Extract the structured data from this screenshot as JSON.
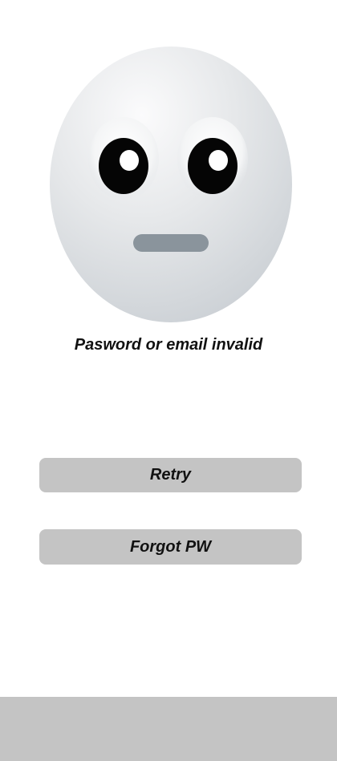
{
  "status": {
    "message": "Pasword or email invalid",
    "illustration_icon": "neutral-face-icon"
  },
  "actions": {
    "retry_label": "Retry",
    "forgot_label": "Forgot PW"
  },
  "colors": {
    "button_bg": "#c4c4c4",
    "bottom_bar_bg": "#c4c4c4",
    "text": "#111111",
    "face_base": "#d5d8dc",
    "mouth": "#8a949c"
  }
}
